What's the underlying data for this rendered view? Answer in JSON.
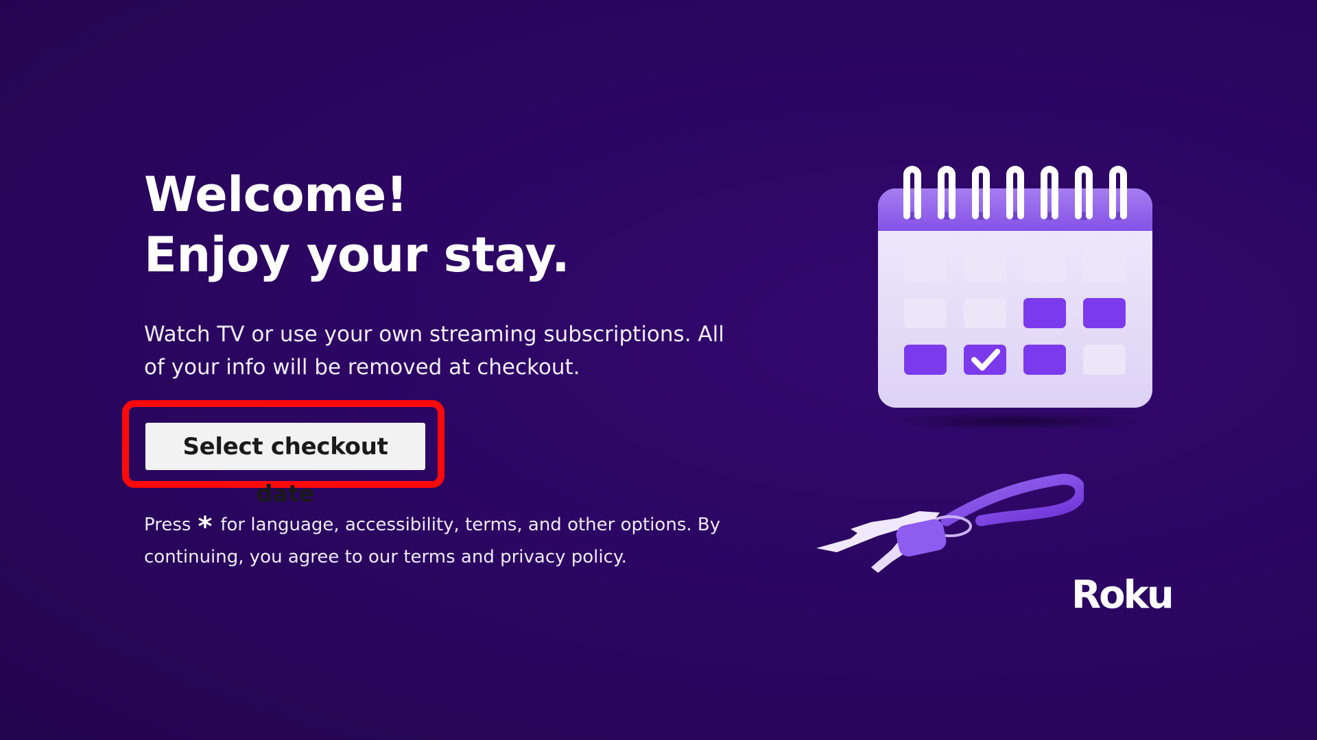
{
  "welcome": {
    "headline_line1": "Welcome!",
    "headline_line2": "Enjoy your stay.",
    "intro": "Watch TV or use your own streaming subscriptions. All of your info will be removed at checkout."
  },
  "actions": {
    "select_checkout_label": "Select checkout date"
  },
  "legal": {
    "press_label": "Press",
    "star_key": "*",
    "notice": "for language, accessibility, terms, and other options. By continuing, you agree to our terms and privacy policy."
  },
  "brand": {
    "logo_text": "Roku"
  },
  "illustrations": {
    "calendar": "calendar-check-icon",
    "keys": "keys-keychain-icon"
  },
  "colors": {
    "background": "#2a0660",
    "accent_purple": "#7c3aed",
    "highlight_frame": "#ff0a0a",
    "button_bg": "#f2f2f2"
  }
}
